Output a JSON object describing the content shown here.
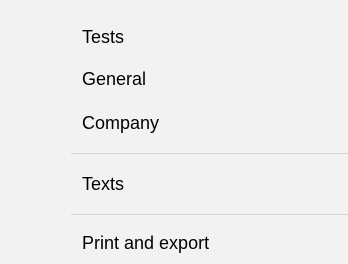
{
  "menu": {
    "items": [
      {
        "label": "Tests"
      },
      {
        "label": "General"
      },
      {
        "label": "Company"
      },
      {
        "label": "Texts"
      },
      {
        "label": "Print and export"
      }
    ]
  },
  "colors": {
    "background": "#f2f2f2",
    "separator": "#d6d6d6",
    "text": "#000000"
  }
}
